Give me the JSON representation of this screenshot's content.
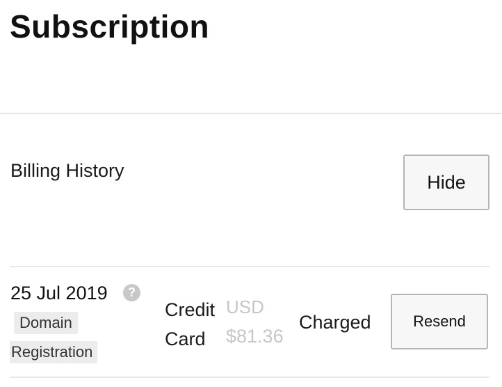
{
  "page": {
    "title": "Subscription"
  },
  "billing": {
    "section_title": "Billing History",
    "hide_label": "Hide",
    "rows": [
      {
        "date": "25 Jul 2019",
        "help_icon": "question-circle-icon",
        "tags": [
          "Domain",
          "Registration"
        ],
        "method_line1": "Credit",
        "method_line2": "Card",
        "currency": "USD",
        "amount": "$81.36",
        "status": "Charged",
        "action_label": "Resend"
      }
    ]
  },
  "colors": {
    "text": "#111111",
    "muted_amount": "#c6c6c6",
    "divider": "#e4e4e4",
    "button_bg": "#f7f7f7",
    "button_border": "#b5b5b5",
    "tag_bg": "#ececec",
    "help_icon_bg": "#c8c8c8"
  }
}
